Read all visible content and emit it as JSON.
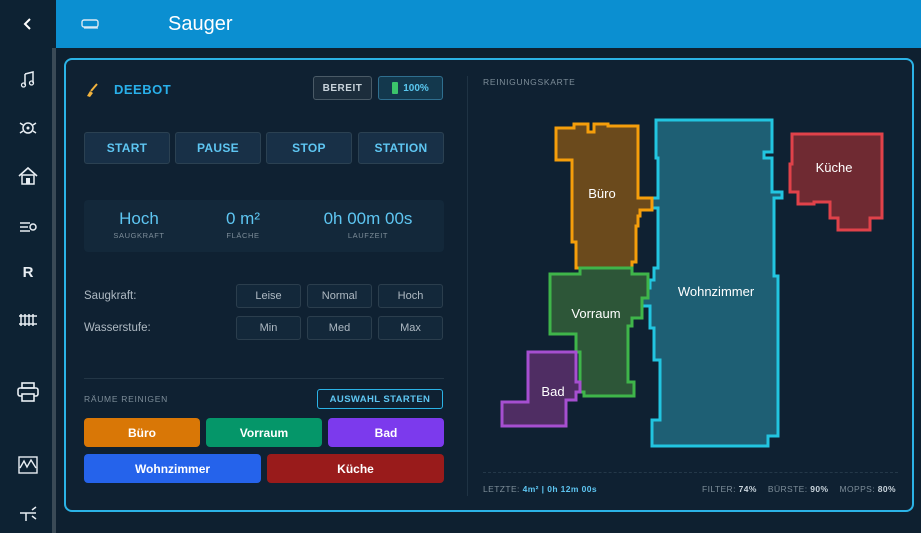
{
  "header": {
    "title": "Sauger"
  },
  "sidebar": {
    "items": [
      {
        "name": "music-icon",
        "glyph": "♫"
      },
      {
        "name": "robot-icon",
        "glyph": ""
      },
      {
        "name": "home-icon",
        "glyph": ""
      },
      {
        "name": "vacuum-icon",
        "glyph": ""
      },
      {
        "name": "r-icon",
        "glyph": "R"
      },
      {
        "name": "radiator-icon",
        "glyph": ""
      },
      {
        "name": "printer-icon",
        "glyph": ""
      },
      {
        "name": "chart-icon",
        "glyph": ""
      },
      {
        "name": "tool-icon",
        "glyph": ""
      }
    ]
  },
  "device": {
    "name": "DEEBOT",
    "status": "BEREIT",
    "battery": "100%"
  },
  "controls": {
    "start": "START",
    "pause": "PAUSE",
    "stop": "STOP",
    "station": "STATION"
  },
  "stats": {
    "suction": {
      "value": "Hoch",
      "label": "SAUGKRAFT"
    },
    "area": {
      "value": "0 m²",
      "label": "FLÄCHE"
    },
    "time": {
      "value": "0h 00m 00s",
      "label": "LAUFZEIT"
    }
  },
  "options": {
    "suction_label": "Saugkraft:",
    "suction_options": [
      "Leise",
      "Normal",
      "Hoch"
    ],
    "water_label": "Wasserstufe:",
    "water_options": [
      "Min",
      "Med",
      "Max"
    ]
  },
  "rooms_section": {
    "title": "RÄUME REINIGEN",
    "start_selection": "AUSWAHL STARTEN",
    "rooms": [
      {
        "label": "Büro",
        "color": "#d97706"
      },
      {
        "label": "Vorraum",
        "color": "#059669"
      },
      {
        "label": "Bad",
        "color": "#7c3aed"
      },
      {
        "label": "Wohnzimmer",
        "color": "#2563eb"
      },
      {
        "label": "Küche",
        "color": "#991b1b"
      }
    ]
  },
  "map": {
    "title": "REINIGUNGSKARTE",
    "rooms": [
      {
        "label": "Büro",
        "fill": "#6b4a1c",
        "stroke": "#f59e0b"
      },
      {
        "label": "Wohnzimmer",
        "fill": "#1e5f74",
        "stroke": "#22c5e0"
      },
      {
        "label": "Küche",
        "fill": "#6f2a32",
        "stroke": "#e0424a"
      },
      {
        "label": "Vorraum",
        "fill": "#2d5638",
        "stroke": "#3fb54a"
      },
      {
        "label": "Bad",
        "fill": "#4f2d63",
        "stroke": "#a64fd0"
      }
    ]
  },
  "footer": {
    "last_label": "LETZTE:",
    "last_value": "4m² | 0h 12m 00s",
    "filter_label": "FILTER:",
    "filter_value": "74%",
    "brush_label": "BÜRSTE:",
    "brush_value": "90%",
    "mop_label": "MOPPS:",
    "mop_value": "80%"
  }
}
